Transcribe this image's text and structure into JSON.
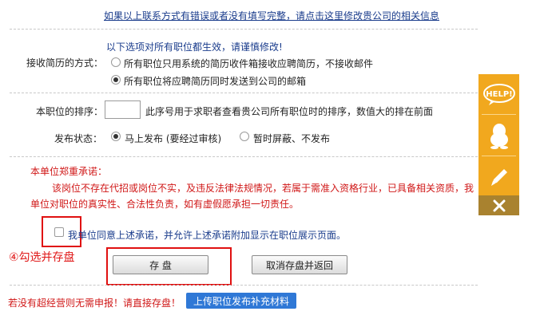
{
  "top_link": "如果以上联系方式有错误或者没有填写完整，请点击这里修改贵公司的相关信息",
  "notice": "以下选项对所有职位都生效，请谨慎修改!",
  "resume_method": {
    "label": "接收简历的方式：",
    "options": [
      "所有职位只用系统的简历收件箱接收应聘简历，不接收邮件",
      "所有职位将应聘简历同时发送到公司的邮箱"
    ]
  },
  "sort": {
    "label": "本职位的排序：",
    "value": "",
    "hint": "此序号用于求职者查看贵公司所有职位时的排序，数值大的排在前面"
  },
  "publish": {
    "label": "发布状态：",
    "options": [
      "马上发布 (要经过审核)",
      "暂时屏蔽、不发布"
    ]
  },
  "commitment": {
    "title": "本单位郑重承诺：",
    "line1": "该岗位不存在代招或岗位不实，及违反法律法规情况，若属于需准入资格行业，已具备相关资质，我",
    "line2": "单位对职位的真实性、合法性负责，如有虚假愿承担一切责任。",
    "agree": "我单位同意上述承诺，并允许上述承诺附加显示在职位展示页面。"
  },
  "annotation": "④勾选并存盘",
  "buttons": {
    "save": "存 盘",
    "cancel": "取消存盘并返回"
  },
  "footer": {
    "warning": "若没有超经营则无需申报！请直接存盘！",
    "upload": "上传职位发布补充材料"
  },
  "sidebar": {
    "help": "HELP!",
    "icons": [
      "help-icon",
      "qq-penguin-icon",
      "pencil-icon",
      "close-icon"
    ],
    "bg": "#f1a81e",
    "close_bg": "#a9822f"
  }
}
